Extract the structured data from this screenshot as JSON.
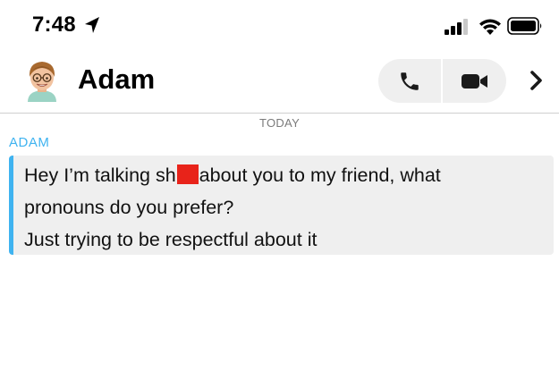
{
  "status_bar": {
    "time": "7:48",
    "icons": [
      "location-arrow-icon",
      "cellular-signal-icon",
      "wifi-icon",
      "battery-icon"
    ]
  },
  "header": {
    "contact_name": "Adam",
    "avatar": "bitmoji-avatar",
    "actions": [
      "phone-icon",
      "video-camera-icon",
      "chevron-right-icon"
    ]
  },
  "conversation": {
    "day_separator": "TODAY",
    "sender_label": "ADAM",
    "message": {
      "line1_before": "Hey I’m talking sh",
      "line1_after": "about you to my friend, what",
      "line2": "pronouns do you prefer?",
      "line3": "Just trying to be respectful about it"
    }
  },
  "colors": {
    "accent": "#3fb3f0",
    "bubble_bg": "#efefef",
    "redaction": "#e8231a",
    "separator_text": "#7b7b7b"
  }
}
